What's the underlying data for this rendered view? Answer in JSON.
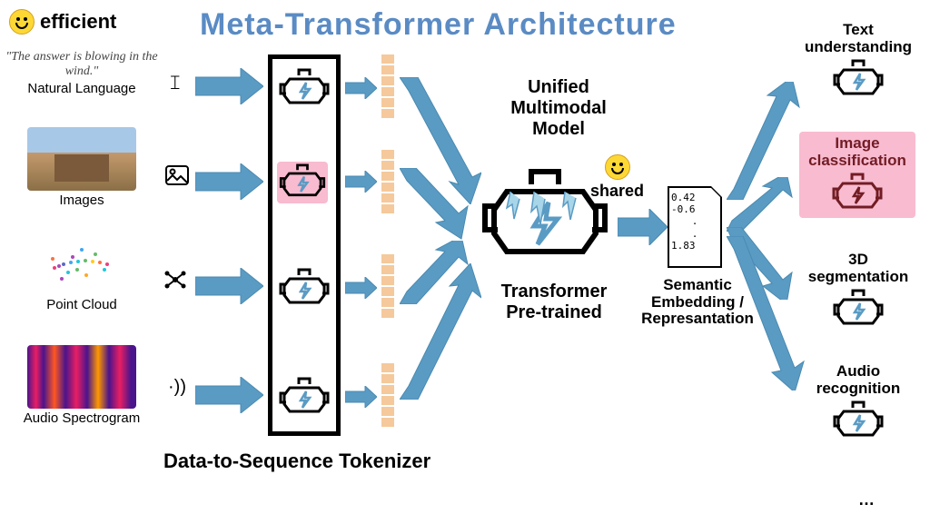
{
  "title": "Meta-Transformer Architecture",
  "badge": "efficient",
  "inputs": {
    "text": {
      "quote": "\"The answer is blowing in the wind.\"",
      "label": "Natural Language"
    },
    "image": {
      "label": "Images"
    },
    "pointcloud": {
      "label": "Point Cloud"
    },
    "audio": {
      "label": "Audio Spectrogram"
    }
  },
  "tokenizer_label": "Data-to-Sequence Tokenizer",
  "center": {
    "top": "Unified\nMultimodal\nModel",
    "bottom": "Transformer\nPre-trained"
  },
  "shared_label": "shared",
  "embedding": {
    "values": [
      "0.42",
      "-0.6",
      ".",
      ".",
      "1.83"
    ],
    "label": "Semantic Embedding / Represantation"
  },
  "outputs": {
    "text": "Text understanding",
    "image": "Image classification",
    "pc": "3D segmentation",
    "audio": "Audio recognition",
    "more": "…"
  }
}
